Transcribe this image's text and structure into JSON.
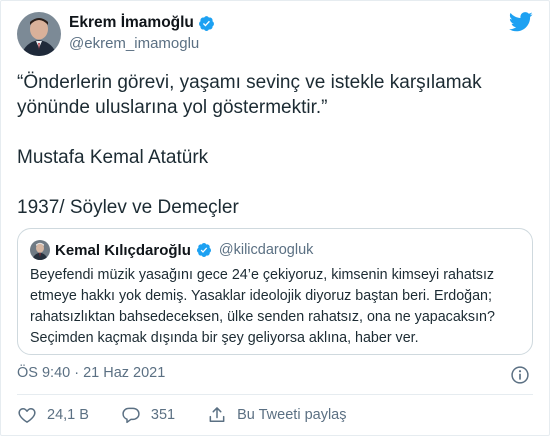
{
  "author": {
    "name": "Ekrem İmamoğlu",
    "handle": "@ekrem_imamoglu"
  },
  "tweet": {
    "line1": "“Önderlerin görevi, yaşamı sevinç ve istekle karşılamak",
    "line2": "yönünde uluslarına yol göstermektir.”",
    "line3": "Mustafa Kemal Atatürk",
    "line4": "1937/ Söylev ve Demeçler"
  },
  "quoted": {
    "name": "Kemal Kılıçdaroğlu",
    "handle": "@kilicdarogluk",
    "lines": [
      "Beyefendi müzik yasağını gece 24’e çekiyoruz, kimsenin kimseyi rahatsız",
      "etmeye hakkı yok demiş. Yasaklar ideolojik diyoruz baştan beri. Erdoğan;",
      "rahatsızlıktan bahsedeceksen, ülke senden rahatsız, ona ne yapacaksın?",
      "Seçimden kaçmak dışında bir şey geliyorsa aklına, haber ver."
    ]
  },
  "meta": {
    "timestamp": "ÖS 9:40 · 21 Haz 2021"
  },
  "actions": {
    "likes": "24,1 B",
    "replies": "351",
    "share_label": "Bu Tweeti paylaş"
  },
  "colors": {
    "brand": "#1da1f2",
    "secondary_text": "#5b7083",
    "like_icon": "#5b7083"
  },
  "icons": {
    "verified": "verified-badge-icon",
    "logo": "twitter-bird-icon",
    "info": "info-icon",
    "like": "heart-icon",
    "reply": "reply-bubble-icon",
    "share": "share-upload-icon"
  }
}
